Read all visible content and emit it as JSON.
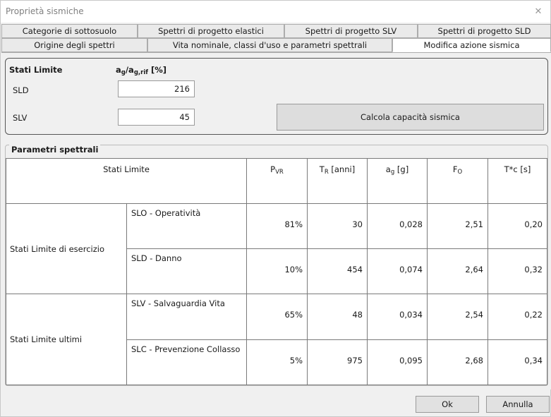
{
  "window": {
    "title": "Proprietà sismiche",
    "close_glyph": "✕"
  },
  "tabs_row1": [
    {
      "label": "Categorie di sottosuolo"
    },
    {
      "label": "Spettri di progetto elastici"
    },
    {
      "label": "Spettri di progetto SLV"
    },
    {
      "label": "Spettri di progetto SLD"
    }
  ],
  "tabs_row2": [
    {
      "label": "Origine degli spettri"
    },
    {
      "label": "Vita nominale, classi d'uso e parametri spettrali"
    },
    {
      "label": "Modifica azione sismica",
      "active": true
    }
  ],
  "stati": {
    "header": "Stati Limite",
    "ratio_main": "a",
    "ratio_sub1": "g",
    "ratio_slash": "/a",
    "ratio_sub2": "g,rif",
    "ratio_unit": " [%]",
    "rows": [
      {
        "label": "SLD",
        "value": "216"
      },
      {
        "label": "SLV",
        "value": "45"
      }
    ],
    "calc_label": "Calcola capacità sismica"
  },
  "params": {
    "legend": "Parametri spettrali",
    "headers": {
      "stati": "Stati Limite",
      "pvr_main": "P",
      "pvr_sub": "VR",
      "tr_main": "T",
      "tr_sub": "R",
      "tr_unit": " [anni]",
      "ag_main": "a",
      "ag_sub": "g",
      "ag_unit": " [g]",
      "fo_main": "F",
      "fo_sub": "O",
      "tc_label": "T*c [s]"
    },
    "groups": [
      {
        "label": "Stati Limite di esercizio",
        "rows": [
          {
            "name": "SLO - Operatività",
            "pvr": "81%",
            "tr": "30",
            "ag": "0,028",
            "fo": "2,51",
            "tc": "0,20"
          },
          {
            "name": "SLD - Danno",
            "pvr": "10%",
            "tr": "454",
            "ag": "0,074",
            "fo": "2,64",
            "tc": "0,32"
          }
        ]
      },
      {
        "label": "Stati Limite ultimi",
        "rows": [
          {
            "name": "SLV - Salvaguardia Vita",
            "pvr": "65%",
            "tr": "48",
            "ag": "0,034",
            "fo": "2,54",
            "tc": "0,22"
          },
          {
            "name": "SLC - Prevenzione Collasso",
            "pvr": "5%",
            "tr": "975",
            "ag": "0,095",
            "fo": "2,68",
            "tc": "0,34"
          }
        ]
      }
    ]
  },
  "buttons": {
    "ok": "Ok",
    "cancel": "Annulla"
  }
}
